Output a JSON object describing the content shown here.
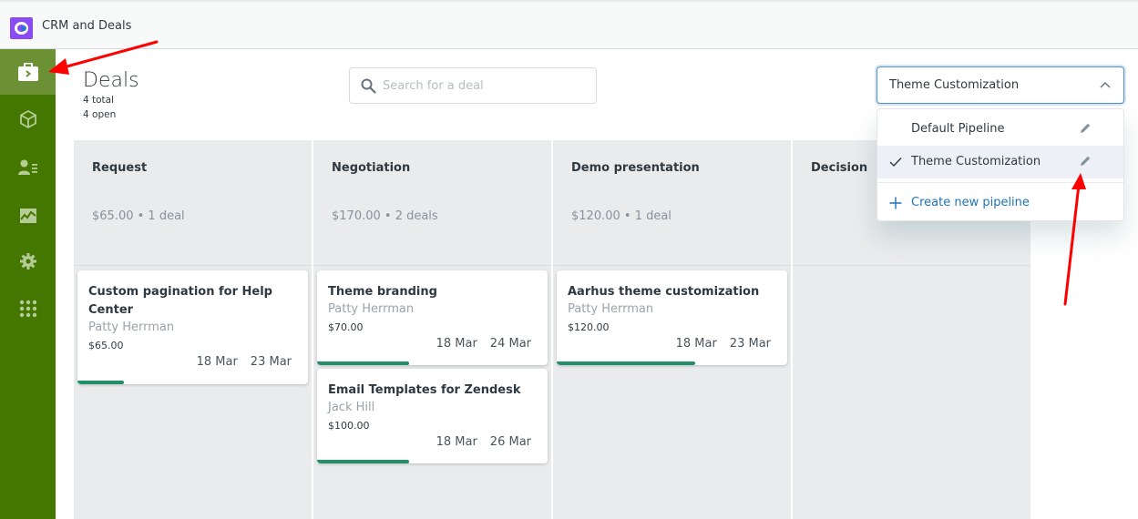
{
  "app": {
    "title": "CRM and Deals",
    "logo_icon": "app-logo-icon",
    "brand_color": "#8a4bf3"
  },
  "sidebar": {
    "bg_color": "#447700",
    "active_color": "#6c9135",
    "items": [
      {
        "name": "deals",
        "icon": "briefcase-icon",
        "active": true
      },
      {
        "name": "products",
        "icon": "cube-icon",
        "active": false
      },
      {
        "name": "contacts",
        "icon": "contact-list-icon",
        "active": false
      },
      {
        "name": "reports",
        "icon": "chart-icon",
        "active": false
      },
      {
        "name": "settings",
        "icon": "gear-icon",
        "active": false
      },
      {
        "name": "apps",
        "icon": "grid-icon",
        "active": false
      }
    ]
  },
  "header": {
    "title": "Deals",
    "total": "4 total",
    "open": "4 open"
  },
  "search": {
    "placeholder": "Search for a deal",
    "value": ""
  },
  "pipeline_select": {
    "selected": "Theme Customization",
    "expanded": true,
    "options": [
      {
        "label": "Default Pipeline",
        "selected": false
      },
      {
        "label": "Theme Customization",
        "selected": true
      }
    ],
    "create_label": "Create new pipeline"
  },
  "board": {
    "progress_color": "#228f67",
    "columns": [
      {
        "name": "Request",
        "stats": "$65.00 • 1 deal",
        "cards": [
          {
            "title": "Custom pagination for Help Center",
            "person": "Patty Herrman",
            "amount": "$65.00",
            "start": "18 Mar",
            "end": "23 Mar",
            "progress": 0.2
          }
        ]
      },
      {
        "name": "Negotiation",
        "stats": "$170.00 • 2 deals",
        "cards": [
          {
            "title": "Theme branding",
            "person": "Patty Herrman",
            "amount": "$70.00",
            "start": "18 Mar",
            "end": "24 Mar",
            "progress": 0.4
          },
          {
            "title": "Email Templates for Zendesk",
            "person": "Jack Hill",
            "amount": "$100.00",
            "start": "18 Mar",
            "end": "26 Mar",
            "progress": 0.4
          }
        ]
      },
      {
        "name": "Demo presentation",
        "stats": "$120.00 • 1 deal",
        "cards": [
          {
            "title": "Aarhus theme customization",
            "person": "Patty Herrman",
            "amount": "$120.00",
            "start": "18 Mar",
            "end": "23 Mar",
            "progress": 0.6
          }
        ]
      },
      {
        "name": "Decision",
        "stats": "",
        "cards": []
      }
    ]
  },
  "annotations": {
    "arrow_color": "#ff0000"
  }
}
